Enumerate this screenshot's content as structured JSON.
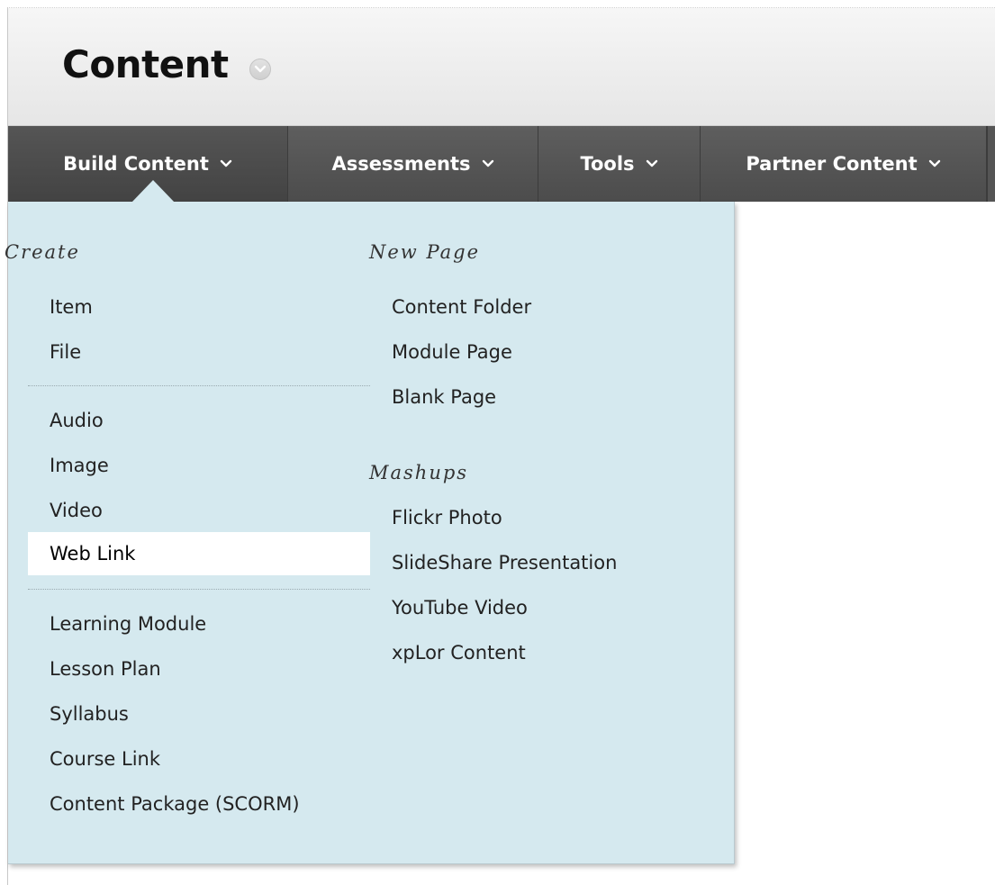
{
  "page": {
    "title": "Content"
  },
  "action_bar": {
    "tabs": [
      {
        "label": "Build Content"
      },
      {
        "label": "Assessments"
      },
      {
        "label": "Tools"
      },
      {
        "label": "Partner Content"
      }
    ]
  },
  "dropdown": {
    "create": {
      "heading": "Create",
      "items": [
        "Item",
        "File",
        "Audio",
        "Image",
        "Video",
        "Web Link",
        "Learning Module",
        "Lesson Plan",
        "Syllabus",
        "Course Link",
        "Content Package (SCORM)"
      ],
      "selected": "Web Link"
    },
    "new_page": {
      "heading": "New Page",
      "items": [
        "Content Folder",
        "Module Page",
        "Blank Page"
      ]
    },
    "mashups": {
      "heading": "Mashups",
      "items": [
        "Flickr Photo",
        "SlideShare Presentation",
        "YouTube Video",
        "xpLor Content"
      ]
    }
  },
  "colors": {
    "dropdown_bg": "#d5e9ef",
    "action_bar_bg": "#555555",
    "selected_bg": "#ffffff"
  }
}
